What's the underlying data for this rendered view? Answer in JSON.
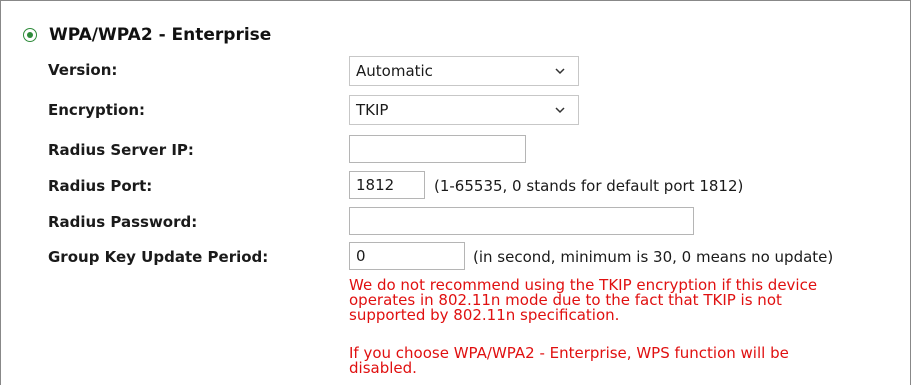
{
  "section": {
    "title": "WPA/WPA2 - Enterprise",
    "selected": true
  },
  "fields": {
    "version": {
      "label": "Version:",
      "value": "Automatic"
    },
    "encryption": {
      "label": "Encryption:",
      "value": "TKIP"
    },
    "radius_server_ip": {
      "label": "Radius Server IP:",
      "value": ""
    },
    "radius_port": {
      "label": "Radius Port:",
      "value": "1812",
      "hint": "(1-65535, 0 stands for default port 1812)"
    },
    "radius_password": {
      "label": "Radius Password:",
      "value": ""
    },
    "group_key_update_period": {
      "label": "Group Key Update Period:",
      "value": "0",
      "hint": "(in second, minimum is 30, 0 means no update)"
    }
  },
  "warnings": {
    "tkip_line1": "We do not recommend using the TKIP encryption if this device",
    "tkip_line2": "operates in 802.11n mode due to the fact that TKIP is not",
    "tkip_line3": "supported by 802.11n specification.",
    "wps_line1": "If you choose WPA/WPA2 - Enterprise, WPS function will be",
    "wps_line2": "disabled."
  },
  "colors": {
    "radio_selected": "#2e8b3a",
    "warning_text": "#e01010",
    "panel_border": "#888888"
  },
  "icons": {
    "radio": "radio-selected-icon",
    "dropdown": "chevron-down-icon"
  }
}
